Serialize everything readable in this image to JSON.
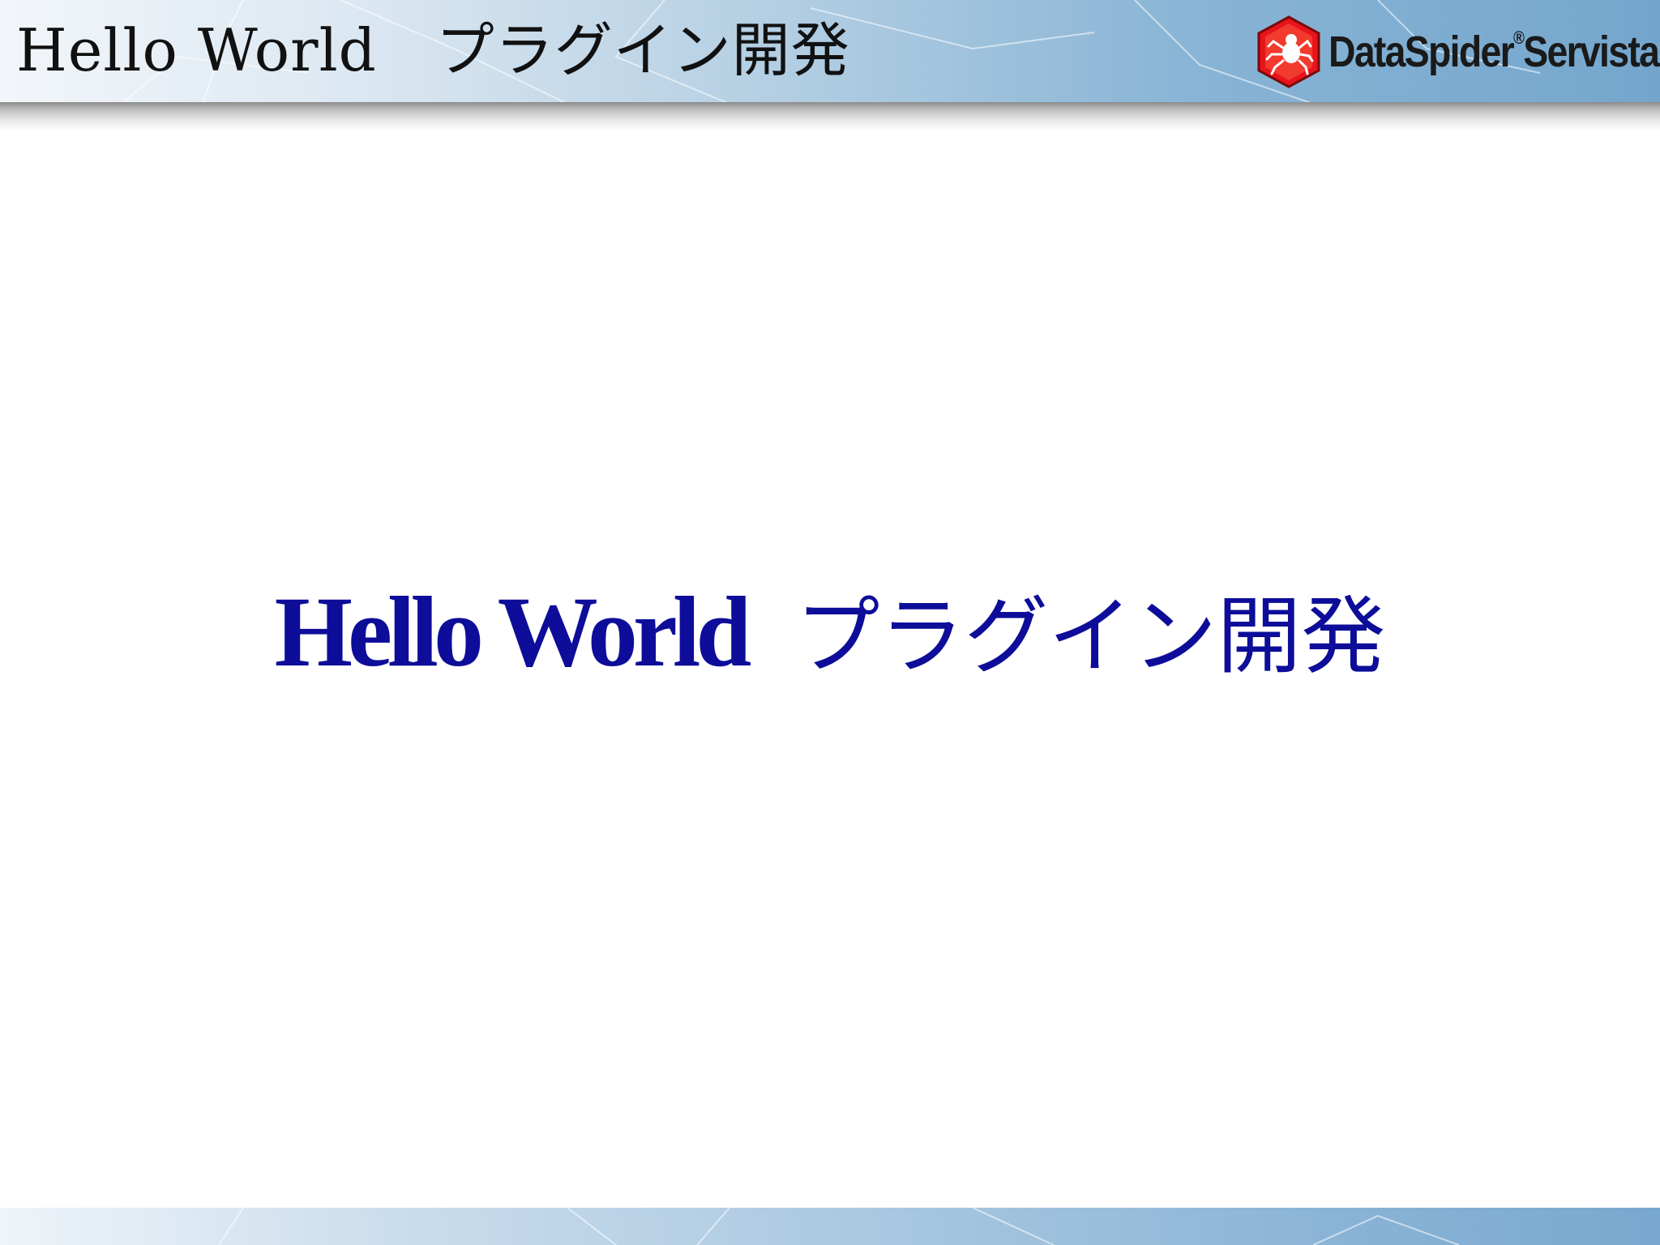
{
  "header": {
    "title": "Hello World　プラグイン開発"
  },
  "logo": {
    "brand_main": "DataSpider",
    "registered_mark": "®",
    "brand_sub": "Servista",
    "icon": "spider-logo-icon",
    "icon_color": "#e8141b"
  },
  "slide": {
    "title_en": "Hello World",
    "title_jp": "プラグイン開発",
    "title_color": "#0d0d9a"
  },
  "colors": {
    "header_light": "#f2f6fa",
    "header_dark": "#74a6cd",
    "footer_dark": "#78a8cf"
  }
}
